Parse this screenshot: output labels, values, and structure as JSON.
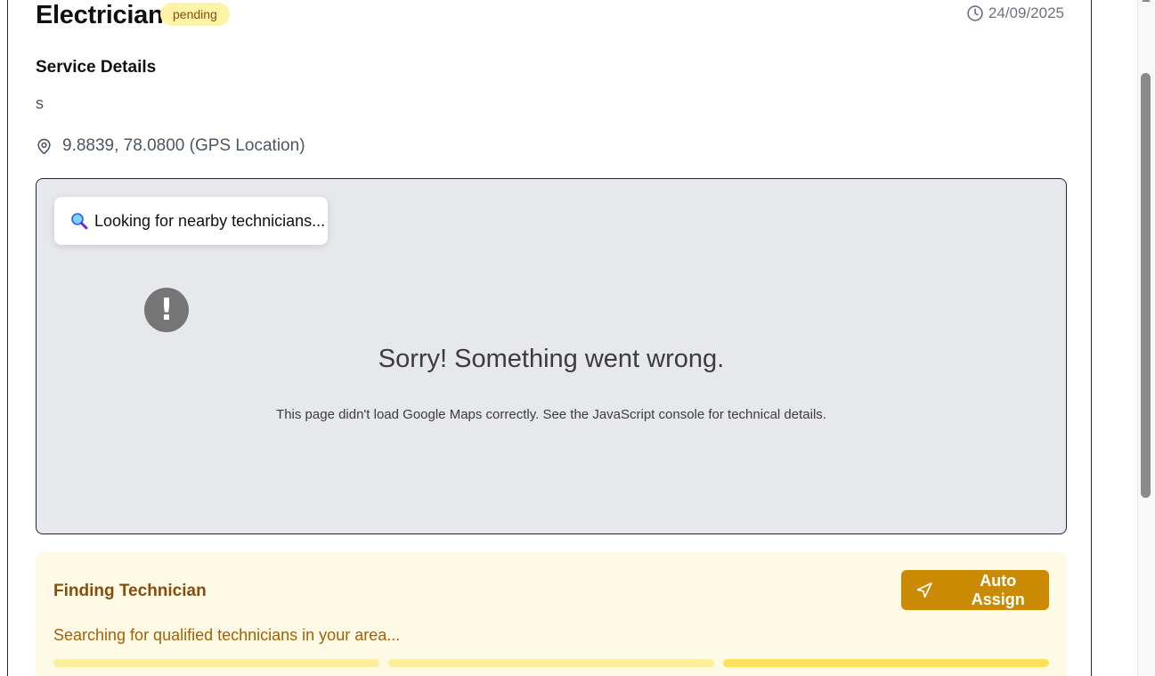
{
  "header": {
    "title": "Electrician",
    "status_badge": "pending",
    "date": "24/09/2025"
  },
  "service": {
    "section_title": "Service Details",
    "description": "s",
    "location": "9.8839, 78.0800 (GPS Location)"
  },
  "map": {
    "searching_label": "Looking for nearby technicians...",
    "error_title": "Sorry! Something went wrong.",
    "error_text": "This page didn't load Google Maps correctly. See the JavaScript console for technical details."
  },
  "finding": {
    "title": "Finding Technician",
    "auto_assign_label": "Auto Assign",
    "status_text": "Searching for qualified technicians in your area...",
    "progress_segments": 3,
    "active_segment": 3
  },
  "colors": {
    "badge_bg": "#fef3a7",
    "badge_text": "#854d0e",
    "finding_bg": "#fefae6",
    "accent": "#ca8a04"
  },
  "icons": {
    "date": "clock-icon",
    "location": "map-pin-icon",
    "search": "magnifier-icon",
    "error": "exclamation-icon",
    "auto_assign": "navigation-arrow-icon"
  }
}
